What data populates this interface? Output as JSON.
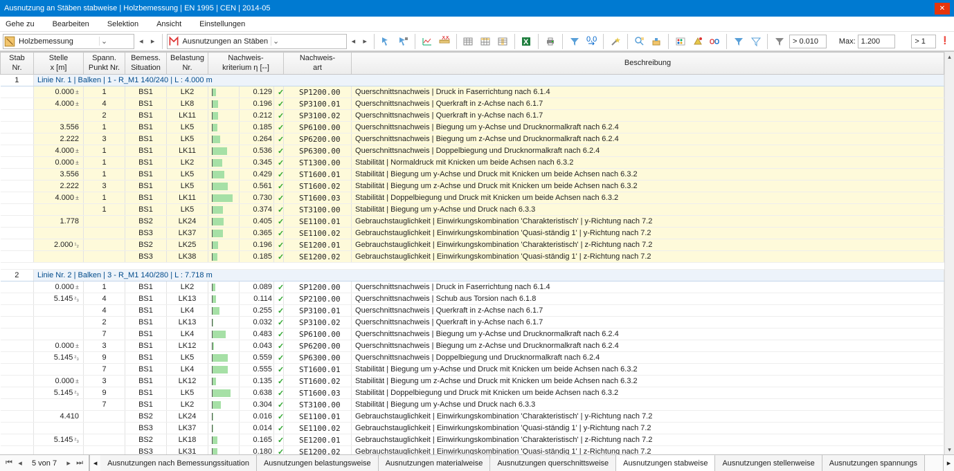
{
  "title": "Ausnutzung an Stäben stabweise | Holzbemessung | EN 1995 | CEN | 2014-05",
  "menu": [
    "Gehe zu",
    "Bearbeiten",
    "Selektion",
    "Ansicht",
    "Einstellungen"
  ],
  "combo1": "Holzbemessung",
  "combo2": "Ausnutzungen an Stäben",
  "filter_gt": "> 0.010",
  "max_label": "Max:",
  "max_value": "1.200",
  "gt1": "> 1",
  "columns": {
    "stab": "Stab\nNr.",
    "stelle": "Stelle\nx [m]",
    "punkt": "Spann.\nPunkt Nr.",
    "sit": "Bemess.\nSituation",
    "last": "Belastung\nNr.",
    "eta": "Nachweis-\nkriterium η [--]",
    "art": "Nachweis-\nart",
    "desc": "Beschreibung"
  },
  "groups": [
    {
      "stab": "1",
      "header": "Linie Nr. 1 | Balken | 1 - R_M1 140/240 | L : 4.000 m",
      "cls": "g1",
      "rows": [
        {
          "stelle": "0.000",
          "sym": "±",
          "punkt": "1",
          "sit": "BS1",
          "last": "LK2",
          "eta": "0.129",
          "art": "SP1200.00",
          "desc": "Querschnittsnachweis | Druck in Faserrichtung nach 6.1.4"
        },
        {
          "stelle": "4.000",
          "sym": "±",
          "punkt": "4",
          "sit": "BS1",
          "last": "LK8",
          "eta": "0.196",
          "art": "SP3100.01",
          "desc": "Querschnittsnachweis | Querkraft in z-Achse nach 6.1.7"
        },
        {
          "stelle": "",
          "sym": "",
          "punkt": "2",
          "sit": "BS1",
          "last": "LK11",
          "eta": "0.212",
          "art": "SP3100.02",
          "desc": "Querschnittsnachweis | Querkraft in y-Achse nach 6.1.7"
        },
        {
          "stelle": "3.556",
          "sym": "",
          "punkt": "1",
          "sit": "BS1",
          "last": "LK5",
          "eta": "0.185",
          "art": "SP6100.00",
          "desc": "Querschnittsnachweis | Biegung um y-Achse und Drucknormalkraft nach 6.2.4"
        },
        {
          "stelle": "2.222",
          "sym": "",
          "punkt": "3",
          "sit": "BS1",
          "last": "LK5",
          "eta": "0.264",
          "art": "SP6200.00",
          "desc": "Querschnittsnachweis | Biegung um z-Achse und Drucknormalkraft nach 6.2.4"
        },
        {
          "stelle": "4.000",
          "sym": "±",
          "punkt": "1",
          "sit": "BS1",
          "last": "LK11",
          "eta": "0.536",
          "art": "SP6300.00",
          "desc": "Querschnittsnachweis | Doppelbiegung und Drucknormalkraft nach 6.2.4"
        },
        {
          "stelle": "0.000",
          "sym": "±",
          "punkt": "1",
          "sit": "BS1",
          "last": "LK2",
          "eta": "0.345",
          "art": "ST1300.00",
          "desc": "Stabilität | Normaldruck mit Knicken um beide Achsen nach 6.3.2"
        },
        {
          "stelle": "3.556",
          "sym": "",
          "punkt": "1",
          "sit": "BS1",
          "last": "LK5",
          "eta": "0.429",
          "art": "ST1600.01",
          "desc": "Stabilität | Biegung um y-Achse und Druck mit Knicken um beide Achsen nach 6.3.2"
        },
        {
          "stelle": "2.222",
          "sym": "",
          "punkt": "3",
          "sit": "BS1",
          "last": "LK5",
          "eta": "0.561",
          "art": "ST1600.02",
          "desc": "Stabilität | Biegung um z-Achse und Druck mit Knicken um beide Achsen nach 6.3.2"
        },
        {
          "stelle": "4.000",
          "sym": "±",
          "punkt": "1",
          "sit": "BS1",
          "last": "LK11",
          "eta": "0.730",
          "art": "ST1600.03",
          "desc": "Stabilität | Doppelbiegung und Druck mit Knicken um beide Achsen nach 6.3.2"
        },
        {
          "stelle": "",
          "sym": "",
          "punkt": "1",
          "sit": "BS1",
          "last": "LK5",
          "eta": "0.374",
          "art": "ST3100.00",
          "desc": "Stabilität | Biegung um y-Achse und Druck nach 6.3.3"
        },
        {
          "stelle": "1.778",
          "sym": "",
          "punkt": "",
          "sit": "BS2",
          "last": "LK24",
          "eta": "0.405",
          "art": "SE1100.01",
          "desc": "Gebrauchstauglichkeit | Einwirkungskombination 'Charakteristisch' | y-Richtung nach 7.2"
        },
        {
          "stelle": "",
          "sym": "",
          "punkt": "",
          "sit": "BS3",
          "last": "LK37",
          "eta": "0.365",
          "art": "SE1100.02",
          "desc": "Gebrauchstauglichkeit | Einwirkungskombination 'Quasi-ständig 1' | y-Richtung nach 7.2"
        },
        {
          "stelle": "2.000",
          "sym": "¹₂",
          "punkt": "",
          "sit": "BS2",
          "last": "LK25",
          "eta": "0.196",
          "art": "SE1200.01",
          "desc": "Gebrauchstauglichkeit | Einwirkungskombination 'Charakteristisch' | z-Richtung nach 7.2"
        },
        {
          "stelle": "",
          "sym": "",
          "punkt": "",
          "sit": "BS3",
          "last": "LK38",
          "eta": "0.185",
          "art": "SE1200.02",
          "desc": "Gebrauchstauglichkeit | Einwirkungskombination 'Quasi-ständig 1' | z-Richtung nach 7.2"
        }
      ]
    },
    {
      "stab": "2",
      "header": "Linie Nr. 2 | Balken | 3 - R_M1 140/280 | L : 7.718 m",
      "cls": "g2",
      "rows": [
        {
          "stelle": "0.000",
          "sym": "±",
          "punkt": "1",
          "sit": "BS1",
          "last": "LK2",
          "eta": "0.089",
          "art": "SP1200.00",
          "desc": "Querschnittsnachweis | Druck in Faserrichtung nach 6.1.4"
        },
        {
          "stelle": "5.145",
          "sym": "²₃",
          "punkt": "4",
          "sit": "BS1",
          "last": "LK13",
          "eta": "0.114",
          "art": "SP2100.00",
          "desc": "Querschnittsnachweis | Schub aus Torsion nach 6.1.8"
        },
        {
          "stelle": "",
          "sym": "",
          "punkt": "4",
          "sit": "BS1",
          "last": "LK4",
          "eta": "0.255",
          "art": "SP3100.01",
          "desc": "Querschnittsnachweis | Querkraft in z-Achse nach 6.1.7"
        },
        {
          "stelle": "",
          "sym": "",
          "punkt": "2",
          "sit": "BS1",
          "last": "LK13",
          "eta": "0.032",
          "art": "SP3100.02",
          "desc": "Querschnittsnachweis | Querkraft in y-Achse nach 6.1.7"
        },
        {
          "stelle": "",
          "sym": "",
          "punkt": "7",
          "sit": "BS1",
          "last": "LK4",
          "eta": "0.483",
          "art": "SP6100.00",
          "desc": "Querschnittsnachweis | Biegung um y-Achse und Drucknormalkraft nach 6.2.4"
        },
        {
          "stelle": "0.000",
          "sym": "±",
          "punkt": "3",
          "sit": "BS1",
          "last": "LK12",
          "eta": "0.043",
          "art": "SP6200.00",
          "desc": "Querschnittsnachweis | Biegung um z-Achse und Drucknormalkraft nach 6.2.4"
        },
        {
          "stelle": "5.145",
          "sym": "²₃",
          "punkt": "9",
          "sit": "BS1",
          "last": "LK5",
          "eta": "0.559",
          "art": "SP6300.00",
          "desc": "Querschnittsnachweis | Doppelbiegung und Drucknormalkraft nach 6.2.4"
        },
        {
          "stelle": "",
          "sym": "",
          "punkt": "7",
          "sit": "BS1",
          "last": "LK4",
          "eta": "0.555",
          "art": "ST1600.01",
          "desc": "Stabilität | Biegung um y-Achse und Druck mit Knicken um beide Achsen nach 6.3.2"
        },
        {
          "stelle": "0.000",
          "sym": "±",
          "punkt": "3",
          "sit": "BS1",
          "last": "LK12",
          "eta": "0.135",
          "art": "ST1600.02",
          "desc": "Stabilität | Biegung um z-Achse und Druck mit Knicken um beide Achsen nach 6.3.2"
        },
        {
          "stelle": "5.145",
          "sym": "²₃",
          "punkt": "9",
          "sit": "BS1",
          "last": "LK5",
          "eta": "0.638",
          "art": "ST1600.03",
          "desc": "Stabilität | Doppelbiegung und Druck mit Knicken um beide Achsen nach 6.3.2"
        },
        {
          "stelle": "",
          "sym": "",
          "punkt": "7",
          "sit": "BS1",
          "last": "LK2",
          "eta": "0.304",
          "art": "ST3100.00",
          "desc": "Stabilität | Biegung um y-Achse und Druck nach 6.3.3"
        },
        {
          "stelle": "4.410",
          "sym": "",
          "punkt": "",
          "sit": "BS2",
          "last": "LK24",
          "eta": "0.016",
          "art": "SE1100.01",
          "desc": "Gebrauchstauglichkeit | Einwirkungskombination 'Charakteristisch' | y-Richtung nach 7.2"
        },
        {
          "stelle": "",
          "sym": "",
          "punkt": "",
          "sit": "BS3",
          "last": "LK37",
          "eta": "0.014",
          "art": "SE1100.02",
          "desc": "Gebrauchstauglichkeit | Einwirkungskombination 'Quasi-ständig 1' | y-Richtung nach 7.2"
        },
        {
          "stelle": "5.145",
          "sym": "²₃",
          "punkt": "",
          "sit": "BS2",
          "last": "LK18",
          "eta": "0.165",
          "art": "SE1200.01",
          "desc": "Gebrauchstauglichkeit | Einwirkungskombination 'Charakteristisch' | z-Richtung nach 7.2"
        },
        {
          "stelle": "",
          "sym": "",
          "punkt": "",
          "sit": "BS3",
          "last": "LK31",
          "eta": "0.180",
          "art": "SE1200.02",
          "desc": "Gebrauchstauglichkeit | Einwirkungskombination 'Quasi-ständig 1' | z-Richtung nach 7.2"
        }
      ]
    }
  ],
  "pager": "5 von 7",
  "tabs": [
    "Ausnutzungen nach Bemessungssituation",
    "Ausnutzungen belastungsweise",
    "Ausnutzungen materialweise",
    "Ausnutzungen querschnittsweise",
    "Ausnutzungen stabweise",
    "Ausnutzungen stellenweise",
    "Ausnutzungen spannungs"
  ],
  "active_tab": 4
}
